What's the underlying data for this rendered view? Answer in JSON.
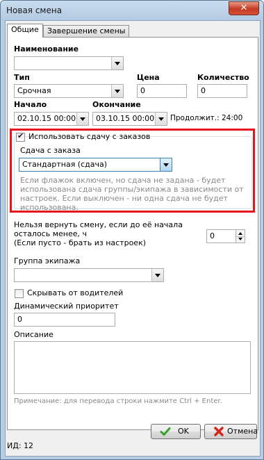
{
  "window": {
    "title": "Новая смена",
    "close_label": "✕"
  },
  "tabs": [
    {
      "label": "Общие",
      "active": true
    },
    {
      "label": "Завершение смены",
      "active": false
    }
  ],
  "form": {
    "name_label": "Наименование",
    "name_value": "",
    "type_label": "Тип",
    "type_value": "Срочная",
    "price_label": "Цена",
    "price_value": "0",
    "qty_label": "Количество",
    "qty_value": "0",
    "start_label": "Начало",
    "start_value": "02.10.15 00:00",
    "end_label": "Окончание",
    "end_value": "03.10.15 00:00",
    "duration_text": "Продолжит.: 24:00",
    "use_order_change_label": "Использовать сдачу с заказов",
    "use_order_change_checked": true,
    "order_change_label": "Сдача с заказа",
    "order_change_value": "Стандартная (сдача)",
    "order_change_hint": [
      "Если флажок включен, но сдача не задана - будет",
      "использована сдача группы/экипажа в зависимости от",
      "настроек. Если выключен - ни одна сдача не будет",
      "использована."
    ],
    "cannot_return_lines": [
      "Нельзя вернуть смену, если до её начала",
      "осталось менее, ч",
      "(Если пусто - брать из настроек)"
    ],
    "cannot_return_value": "0",
    "crew_group_label": "Группа экипажа",
    "crew_group_value": "",
    "hide_from_drivers_label": "Скрывать от водителей",
    "hide_from_drivers_checked": false,
    "dyn_priority_label": "Динамический приоритет",
    "dyn_priority_value": "0",
    "description_label": "Описание",
    "description_value": "",
    "note": "Примечание: для перевода строки нажмите Ctrl + Enter."
  },
  "buttons": {
    "ok_label": "OK",
    "cancel_label": "Отмена"
  },
  "status": {
    "id_text": "ИД: 12"
  },
  "colors": {
    "highlight_frame": "#e8141c",
    "ok_icon": "#3aa02c",
    "cancel_icon": "#d2261b"
  }
}
